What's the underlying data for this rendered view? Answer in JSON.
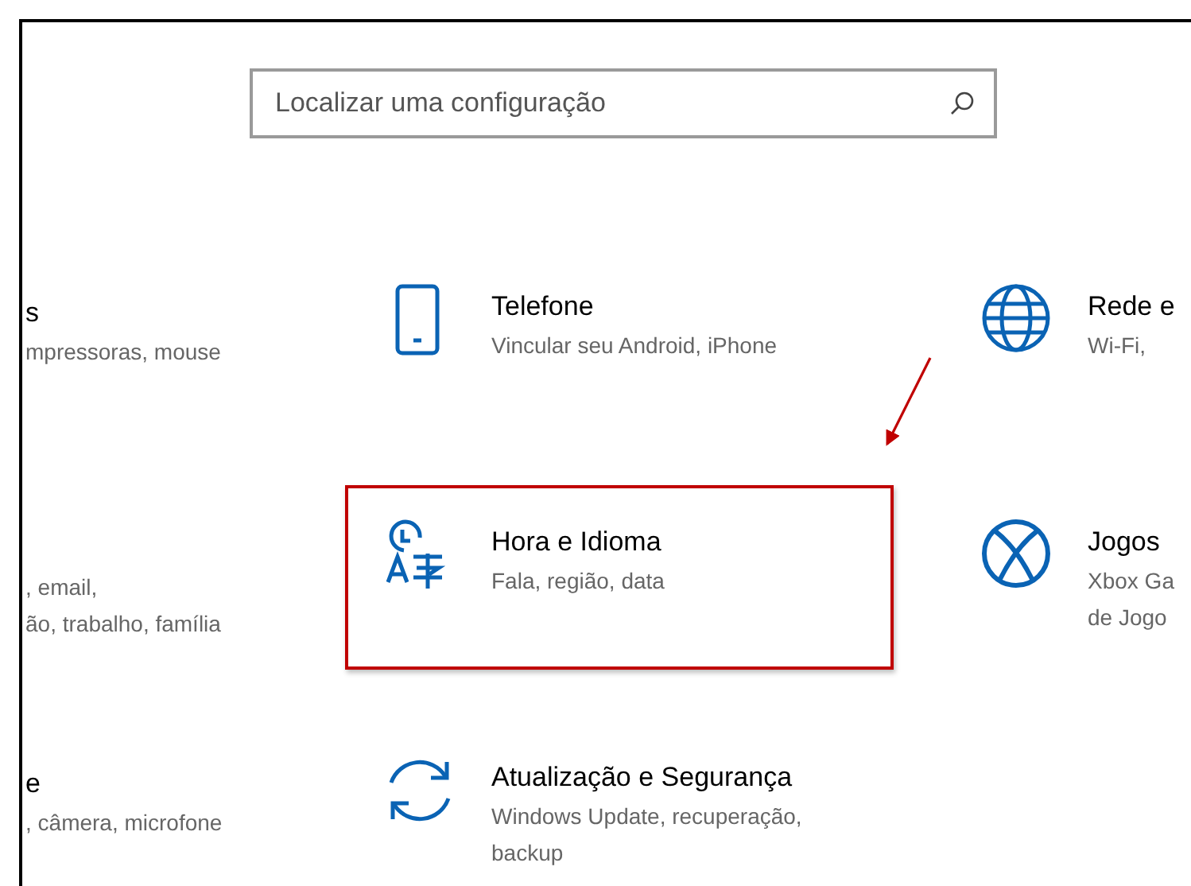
{
  "search": {
    "placeholder": "Localizar uma configuração"
  },
  "tiles": [
    {
      "kind": "clipped",
      "title": "s",
      "subtitle": [
        "mpressoras, mouse"
      ],
      "highlighted": false
    },
    {
      "kind": "phone",
      "title": "Telefone",
      "subtitle": [
        "Vincular seu Android, iPhone"
      ],
      "highlighted": false
    },
    {
      "kind": "globe",
      "title": "Rede e",
      "subtitle": [
        "Wi-Fi,"
      ],
      "highlighted": false
    },
    {
      "kind": "clipped",
      "subtitle": [
        ", email,",
        "ão, trabalho, família"
      ],
      "highlighted": false
    },
    {
      "kind": "language",
      "title": "Hora e Idioma",
      "subtitle": [
        "Fala, região, data"
      ],
      "highlighted": true
    },
    {
      "kind": "xbox",
      "title": "Jogos",
      "subtitle": [
        "Xbox Ga",
        "de Jogo"
      ],
      "highlighted": false
    },
    {
      "kind": "clipped",
      "title": "e",
      "subtitle": [
        ", câmera, microfone"
      ],
      "highlighted": false
    },
    {
      "kind": "sync",
      "title": "Atualização e Segurança",
      "subtitle": [
        "Windows Update, recuperação,",
        "backup"
      ],
      "highlighted": false
    }
  ]
}
